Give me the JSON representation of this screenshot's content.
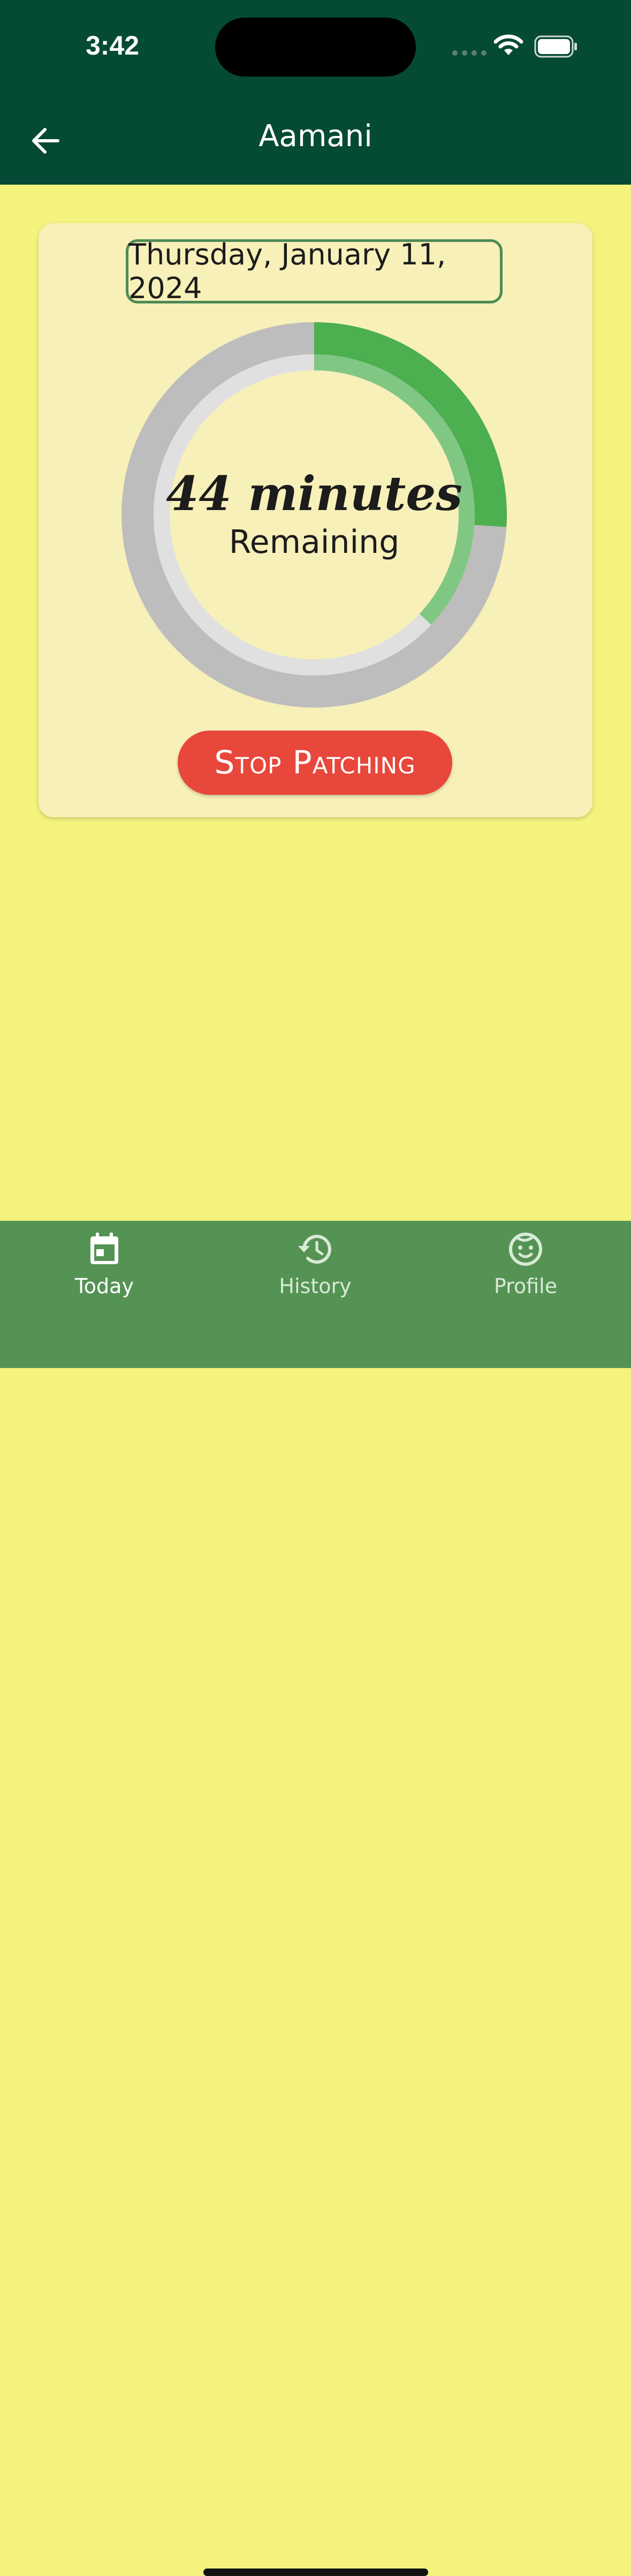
{
  "status_bar": {
    "time": "3:42"
  },
  "app_bar": {
    "title": "Aamani"
  },
  "card": {
    "date": "Thursday, January 11, 2024",
    "timer": {
      "minutes_text": "44 minutes",
      "remaining_label": "Remaining"
    },
    "progress": {
      "outer_fraction": 0.26,
      "inner_fraction": 0.37
    },
    "stop_button_label": "Stop Patching"
  },
  "tabs": [
    {
      "label": "Today",
      "icon": "calendar-icon",
      "active": true
    },
    {
      "label": "History",
      "icon": "history-icon",
      "active": false
    },
    {
      "label": "Profile",
      "icon": "face-icon",
      "active": false
    }
  ],
  "colors": {
    "header": "#054a35",
    "background": "#f3f37e",
    "card": "#f7f0b8",
    "ring_track_outer": "#bdbdbd",
    "ring_track_inner": "#e0e0e0",
    "ring_progress_outer": "#4caf50",
    "ring_progress_inner": "#81c784",
    "stop_button": "#e8473b",
    "tab_bar": "#559355"
  }
}
